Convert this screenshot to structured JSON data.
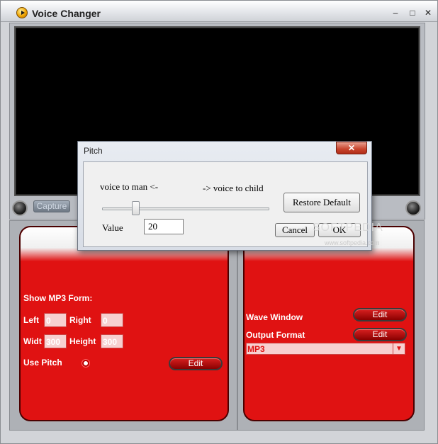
{
  "window": {
    "title": "Voice Changer",
    "minimize": "–",
    "maximize": "□",
    "close": "✕"
  },
  "display": {
    "capture_label": "Capture"
  },
  "mp3_panel": {
    "heading": "Show MP3 Form:",
    "left_label": "Left",
    "left_value": "0",
    "right_label": "Right",
    "right_value": "0",
    "width_label": "Widt",
    "width_value": "300",
    "height_label": "Height",
    "height_value": "300",
    "pitch_label": "Use Pitch",
    "edit_label": "Edit"
  },
  "wave_panel": {
    "wave_label": "Wave Window",
    "wave_edit": "Edit",
    "output_label": "Output Format",
    "output_edit": "Edit",
    "format_value": "MP3",
    "format_arrow": "▼"
  },
  "pitch_dialog": {
    "title": "Pitch",
    "close": "✕",
    "left_caption": "voice to man <-",
    "right_caption": "-> voice to child",
    "value_label": "Value",
    "value": "20",
    "slider_value": 20,
    "restore_label": "Restore Default",
    "cancel_label": "Cancel",
    "ok_label": "OK"
  },
  "watermark": {
    "text": "SOFTPEDIA",
    "sub": "www.softpedia.com"
  }
}
